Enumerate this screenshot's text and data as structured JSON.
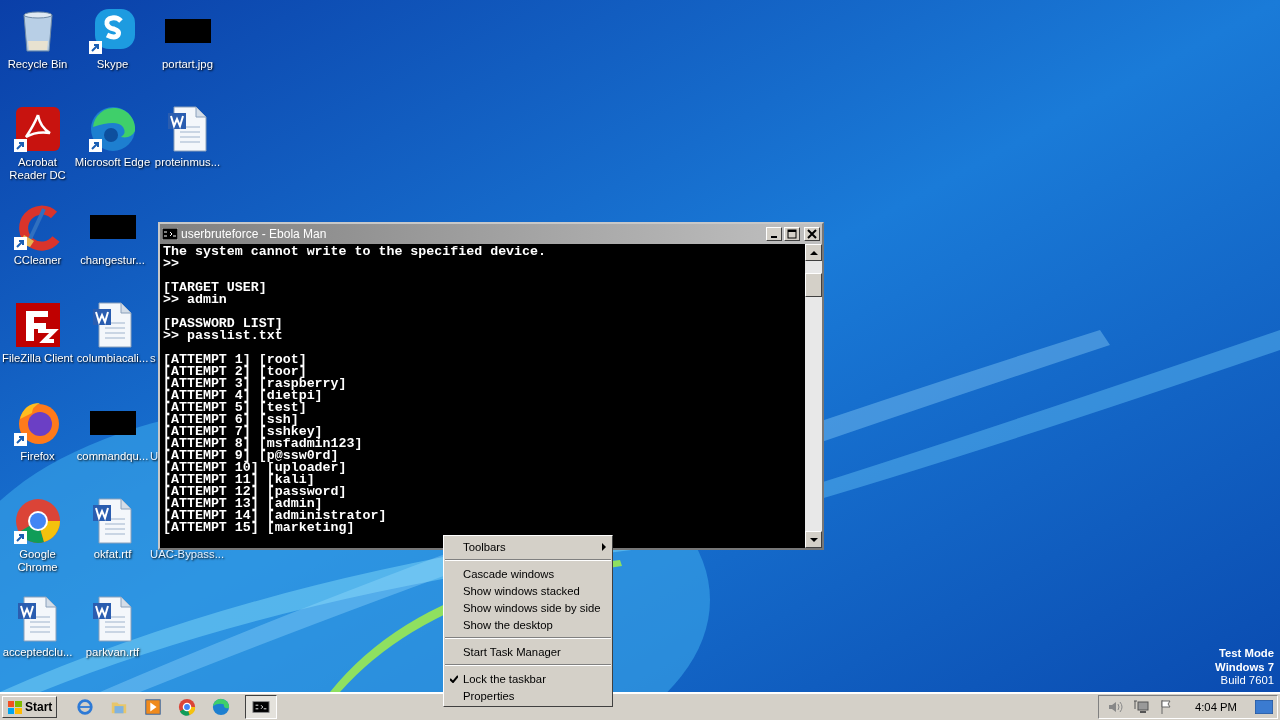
{
  "desktop": {
    "columns": [
      [
        {
          "label": "Recycle Bin",
          "kind": "recycle"
        },
        {
          "label": "Acrobat\nReader DC",
          "kind": "acrobat"
        },
        {
          "label": "CCleaner",
          "kind": "ccleaner"
        },
        {
          "label": "FileZilla Client",
          "kind": "filezilla"
        },
        {
          "label": "Firefox",
          "kind": "firefox"
        },
        {
          "label": "Google\nChrome",
          "kind": "chrome"
        },
        {
          "label": "acceptedclu...",
          "kind": "word"
        }
      ],
      [
        {
          "label": "Skype",
          "kind": "skype"
        },
        {
          "label": "Microsoft Edge",
          "kind": "edge"
        },
        {
          "label": "changestur...",
          "kind": "redacted"
        },
        {
          "label": "columbiacali...",
          "kind": "word"
        },
        {
          "label": "commandqu...",
          "kind": "redacted"
        },
        {
          "label": "okfat.rtf",
          "kind": "word"
        },
        {
          "label": "parkvan.rtf",
          "kind": "word"
        }
      ],
      [
        {
          "label": "portart.jpg",
          "kind": "redacted"
        },
        {
          "label": "proteinmus...",
          "kind": "word"
        },
        {
          "kind": "empty"
        },
        {
          "label": "s",
          "kind": "covered"
        },
        {
          "label": "U",
          "kind": "covered"
        },
        {
          "label": "UAC-Bypass...",
          "kind": "covered"
        },
        {
          "kind": "empty"
        }
      ]
    ]
  },
  "console": {
    "title": "userbruteforce - Ebola Man",
    "blocks": [
      [
        "The system cannot write to the specified device.",
        ">>"
      ],
      [
        "[TARGET USER]",
        ">> admin"
      ],
      [
        "[PASSWORD LIST]",
        ">> passlist.txt"
      ],
      [
        "[ATTEMPT 1] [root]",
        "[ATTEMPT 2] [toor]",
        "[ATTEMPT 3] [raspberry]",
        "[ATTEMPT 4] [dietpi]",
        "[ATTEMPT 5] [test]",
        "[ATTEMPT 6] [ssh]",
        "[ATTEMPT 7] [sshkey]",
        "[ATTEMPT 8] [msfadmin123]",
        "[ATTEMPT 9] [p@ssw0rd]",
        "[ATTEMPT 10] [uploader]",
        "[ATTEMPT 11] [kali]",
        "[ATTEMPT 12] [password]",
        "[ATTEMPT 13] [admin]",
        "[ATTEMPT 14] [administrator]",
        "[ATTEMPT 15] [marketing]"
      ]
    ]
  },
  "context_menu": {
    "items": [
      {
        "label": "Toolbars",
        "kind": "submenu"
      },
      {
        "kind": "separator"
      },
      {
        "label": "Cascade windows",
        "kind": "item",
        "checked": false
      },
      {
        "label": "Show windows stacked",
        "kind": "item",
        "checked": false
      },
      {
        "label": "Show windows side by side",
        "kind": "item",
        "checked": false
      },
      {
        "label": "Show the desktop",
        "kind": "item",
        "checked": false
      },
      {
        "kind": "separator"
      },
      {
        "label": "Start Task Manager",
        "kind": "item",
        "checked": false
      },
      {
        "kind": "separator"
      },
      {
        "label": "Lock the taskbar",
        "kind": "item",
        "checked": true
      },
      {
        "label": "Properties",
        "kind": "item",
        "checked": false
      }
    ]
  },
  "watermark_text": [
    "Test Mode",
    "Windows 7",
    "Build 7601"
  ],
  "taskbar": {
    "start": "Start",
    "pinned": [
      {
        "kind": "ie",
        "selected": false
      },
      {
        "kind": "folder",
        "selected": false
      },
      {
        "kind": "media",
        "selected": false
      },
      {
        "kind": "chrome",
        "selected": false
      },
      {
        "kind": "edge",
        "selected": false
      },
      {
        "kind": "cmd",
        "selected": true
      }
    ],
    "clock": "4:04 PM"
  }
}
